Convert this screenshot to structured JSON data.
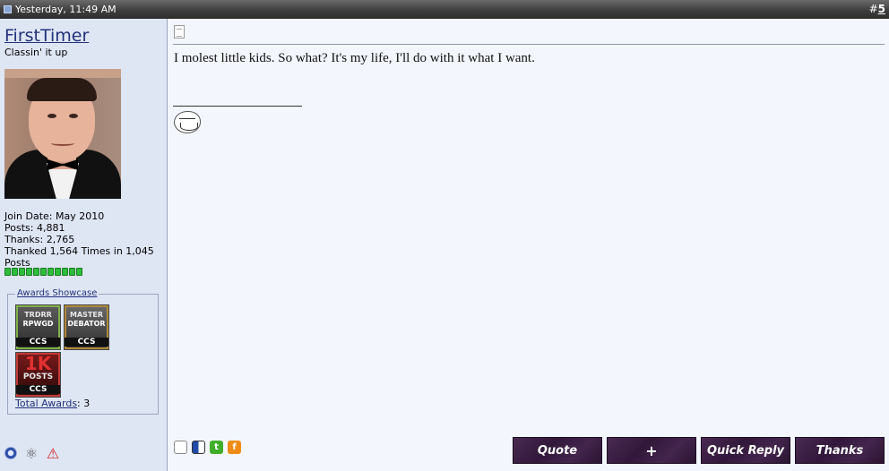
{
  "header": {
    "date": "Yesterday, 11:49 AM",
    "post_number_prefix": "#",
    "post_number": "5"
  },
  "user": {
    "name": "FirstTimer",
    "title": "Classin' it up",
    "join_date": "Join Date: May 2010",
    "posts": "Posts: 4,881",
    "thanks": "Thanks: 2,765",
    "thanked": "Thanked 1,564 Times in 1,045",
    "thanked_suffix": "Posts",
    "reputation_pips": 11,
    "reputation_color": "#2ebd3a"
  },
  "awards": {
    "legend": "Awards Showcase",
    "items": [
      {
        "line1": "TRDRR",
        "line2": "RPWGD",
        "badge": "CCS"
      },
      {
        "line1": "MASTER",
        "line2": "DEBATOR",
        "badge": "CCS"
      },
      {
        "big": "1K",
        "line1": "POSTS",
        "badge": "CCS"
      }
    ],
    "total_label": "Total Awards",
    "total_value": ": 3"
  },
  "post": {
    "message": "I molest little kids. So what? It's my life, I'll do with it what I want."
  },
  "icons": {
    "online": "online-status-icon",
    "ip": "ip-icon",
    "report": "report-icon",
    "signature": "trollface-icon",
    "social": [
      "digg-icon",
      "delicious-icon",
      "technorati-icon",
      "furl-icon"
    ]
  },
  "buttons": {
    "quote": "Quote",
    "multiquote": "+",
    "quick_reply": "Quick Reply",
    "thanks": "Thanks"
  },
  "colors": {
    "header_bg": "#3e3e3e",
    "sidebar_bg": "#dee6f4",
    "content_bg": "#f3f6fc",
    "link": "#22317a",
    "button_bg": "#31183a"
  }
}
